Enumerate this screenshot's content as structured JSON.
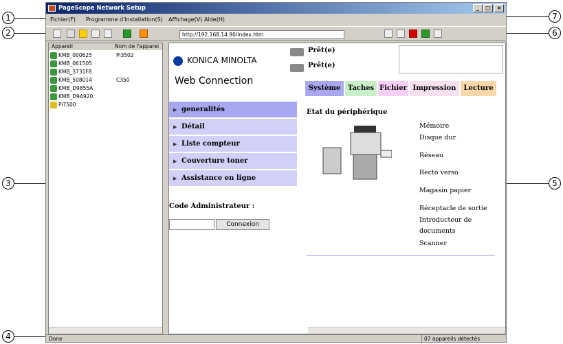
{
  "window": {
    "title": "PageScope Network Setup"
  },
  "menu": [
    "Fichier(F)",
    "Programme d'installation(S)",
    "Affichage(V)",
    "Aide(H)"
  ],
  "address": {
    "url": "http://192.168.14.90/index.htm"
  },
  "callouts": [
    "1",
    "2",
    "3",
    "4",
    "5",
    "6",
    "7"
  ],
  "device_list": {
    "columns": [
      "Appareil",
      "Nom de l'apparei"
    ],
    "rows": [
      {
        "name": "KMB_000625",
        "model": "Pi3502"
      },
      {
        "name": "KMB_061505",
        "model": ""
      },
      {
        "name": "KMB_3731F8",
        "model": ""
      },
      {
        "name": "KMB_508014",
        "model": "C350"
      },
      {
        "name": "KMB_D9855A",
        "model": ""
      },
      {
        "name": "KMB_D9A920",
        "model": ""
      },
      {
        "name": "Pi7500",
        "model": ""
      }
    ]
  },
  "web": {
    "brand": "KONICA MINOLTA",
    "product": "Web Connection",
    "status1": "Prêt(e)",
    "status2": "Prêt(e)",
    "tabs": [
      "Système",
      "Taches",
      "Fichier",
      "Impression",
      "Lecture"
    ],
    "side_menu": [
      "generalités",
      "Détail",
      "Liste compteur",
      "Couverture toner",
      "Assistance en ligne"
    ],
    "admin_label": "Code Administrateur :",
    "login_button": "Connexion",
    "section_title": "Etat du périphérique",
    "options": [
      "Mémoire",
      "Disque dur",
      "Réseau",
      "Recto verso",
      "Magasin papier",
      "Réceptacle de sortie",
      "Introducteur de",
      "documents",
      "Scanner"
    ]
  },
  "status": {
    "left": "Done",
    "right": "07 appareils détectés"
  }
}
